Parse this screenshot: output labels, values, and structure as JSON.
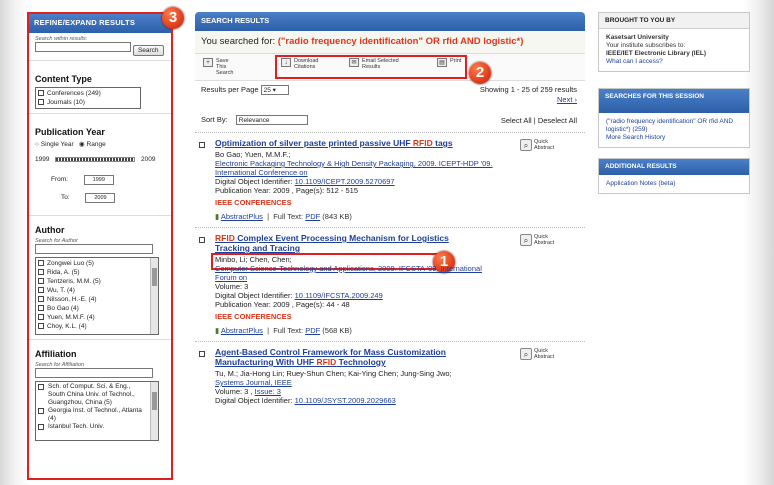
{
  "refine": {
    "header": "REFINE/EXPAND RESULTS",
    "search_label": "Search within results:",
    "search_button": "Search",
    "content_type": {
      "title": "Content Type",
      "items": [
        "Conferences (249)",
        "Journals (10)"
      ]
    },
    "pub_year": {
      "title": "Publication Year",
      "single": "Single Year",
      "range": "Range",
      "start": "1999",
      "end": "2009",
      "from_label": "From:",
      "from_value": "1999",
      "to_label": "To:",
      "to_value": "2009"
    },
    "author": {
      "title": "Author",
      "search_label": "Search for Author",
      "items": [
        "Zongwei Luo (5)",
        "Rida, A. (5)",
        "Tentzeris, M.M. (5)",
        "Wu, T. (4)",
        "Nilsson, H.-E. (4)",
        "Bo Gao (4)",
        "Yuen, M.M.F. (4)",
        "Choy, K.L. (4)"
      ]
    },
    "affiliation": {
      "title": "Affiliation",
      "search_label": "Search for Affiliation",
      "items": [
        "Sch. of Comput. Sci. & Eng., South China Univ. of Technol., Guangzhou, China (5)",
        "Georgia Inst. of Technol., Atlanta (4)",
        "Istanbul Tech. Univ."
      ]
    }
  },
  "main": {
    "header": "SEARCH RESULTS",
    "searched_prefix": "You searched for:",
    "query": "(\"radio frequency identification\" OR rfid AND logistic*)",
    "actions": {
      "save": "Save This Search",
      "download": "Download Citations",
      "email": "Email Selected Results",
      "print": "Print"
    },
    "per_page_label": "Results per Page",
    "per_page_value": "25",
    "showing": "Showing 1 - 25 of 259 results",
    "next": "Next",
    "sort_label": "Sort By:",
    "sort_value": "Relevance",
    "select_all": "Select All",
    "deselect_all": "Deselect All",
    "quick_abstract": "Quick Abstract",
    "results": [
      {
        "title_a": "Optimization of silver paste printed passive UHF",
        "title_hl": "RFID",
        "title_b": " tags",
        "authors": "Bo Gao; Yuen, M.M.F.;",
        "source": "Electronic Packaging Technology & High Density Packaging, 2009. ICEPT-HDP '09. International Conference on",
        "doi_label": "Digital Object Identifier:",
        "doi": "10.1109/ICEPT.2009.5270697",
        "meta": "Publication Year: 2009 , Page(s): 512 - 515",
        "type": "IEEE CONFERENCES",
        "abstract": "AbstractPlus",
        "fulltext": "Full Text:",
        "pdf": "PDF",
        "size": "(843 KB)"
      },
      {
        "title_hl": "RFID",
        "title_a": " Complex Event Processing Mechanism for Logistics Tracking and Tracing",
        "authors": "Minbo, Li; Chen, Chen;",
        "source": "Computer Science-Technology and Applications, 2009. IFCSTA '09. International Forum on",
        "volume": "Volume: 3",
        "doi_label": "Digital Object Identifier:",
        "doi": "10.1109/IFCSTA.2009.249",
        "meta": "Publication Year: 2009 , Page(s): 44 - 48",
        "type": "IEEE CONFERENCES",
        "abstract": "AbstractPlus",
        "fulltext": "Full Text:",
        "pdf": "PDF",
        "size": "(568 KB)"
      },
      {
        "title_a": "Agent-Based Control Framework for Mass Customization Manufacturing With UHF",
        "title_hl": "RFID",
        "title_b": " Technology",
        "authors": "Tu, M.; Jia-Hong Lin; Ruey-Shun Chen; Kai-Ying Chen; Jung-Sing Jwo;",
        "source": "Systems Journal, IEEE",
        "volume": "Volume: 3 ,",
        "issue": "Issue: 3",
        "doi_label": "Digital Object Identifier:",
        "doi": "10.1109/JSYST.2009.2029663"
      }
    ]
  },
  "right": {
    "brought": {
      "title": "BROUGHT TO YOU BY",
      "org": "Kasetsart University",
      "line": "Your institute subscribes to:",
      "lib": "IEEE/IET Electronic Library (IEL)",
      "q": "What can I access?"
    },
    "searches": {
      "title": "SEARCHES FOR THIS SESSION",
      "item": "(\"radio frequency identification\" OR rfid AND logistic*) (259)",
      "more": "More Search History"
    },
    "additional": {
      "title": "ADDITIONAL RESULTS",
      "item": "Application Notes (beta)"
    }
  },
  "badges": {
    "one": "1",
    "two": "2",
    "three": "3"
  }
}
